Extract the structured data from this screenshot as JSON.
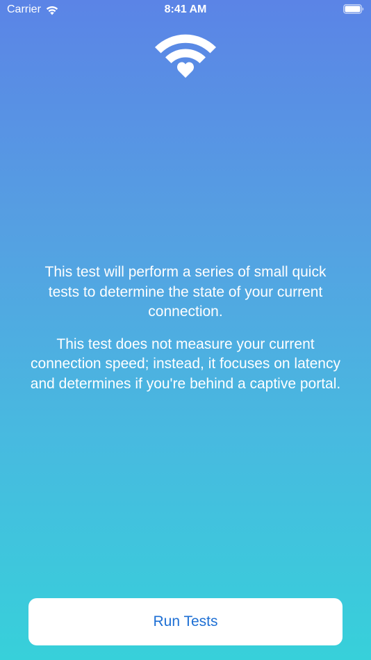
{
  "status_bar": {
    "carrier": "Carrier",
    "time": "8:41 AM",
    "wifi_icon": "wifi-icon",
    "battery_icon": "battery-icon"
  },
  "logo": {
    "icon": "wifi-heart-icon",
    "color": "#ffffff"
  },
  "description": {
    "paragraph_1": "This test will perform a series of small quick tests to determine the state of your current connection.",
    "paragraph_2": "This test does not measure your current connection speed; instead, it focuses on latency and determines if you're behind a captive portal."
  },
  "actions": {
    "run_tests_label": "Run Tests"
  },
  "colors": {
    "gradient_top": "#5b84e6",
    "gradient_bottom": "#37d0da",
    "button_text": "#1d6fd4",
    "button_background": "#ffffff",
    "text": "#ffffff"
  }
}
